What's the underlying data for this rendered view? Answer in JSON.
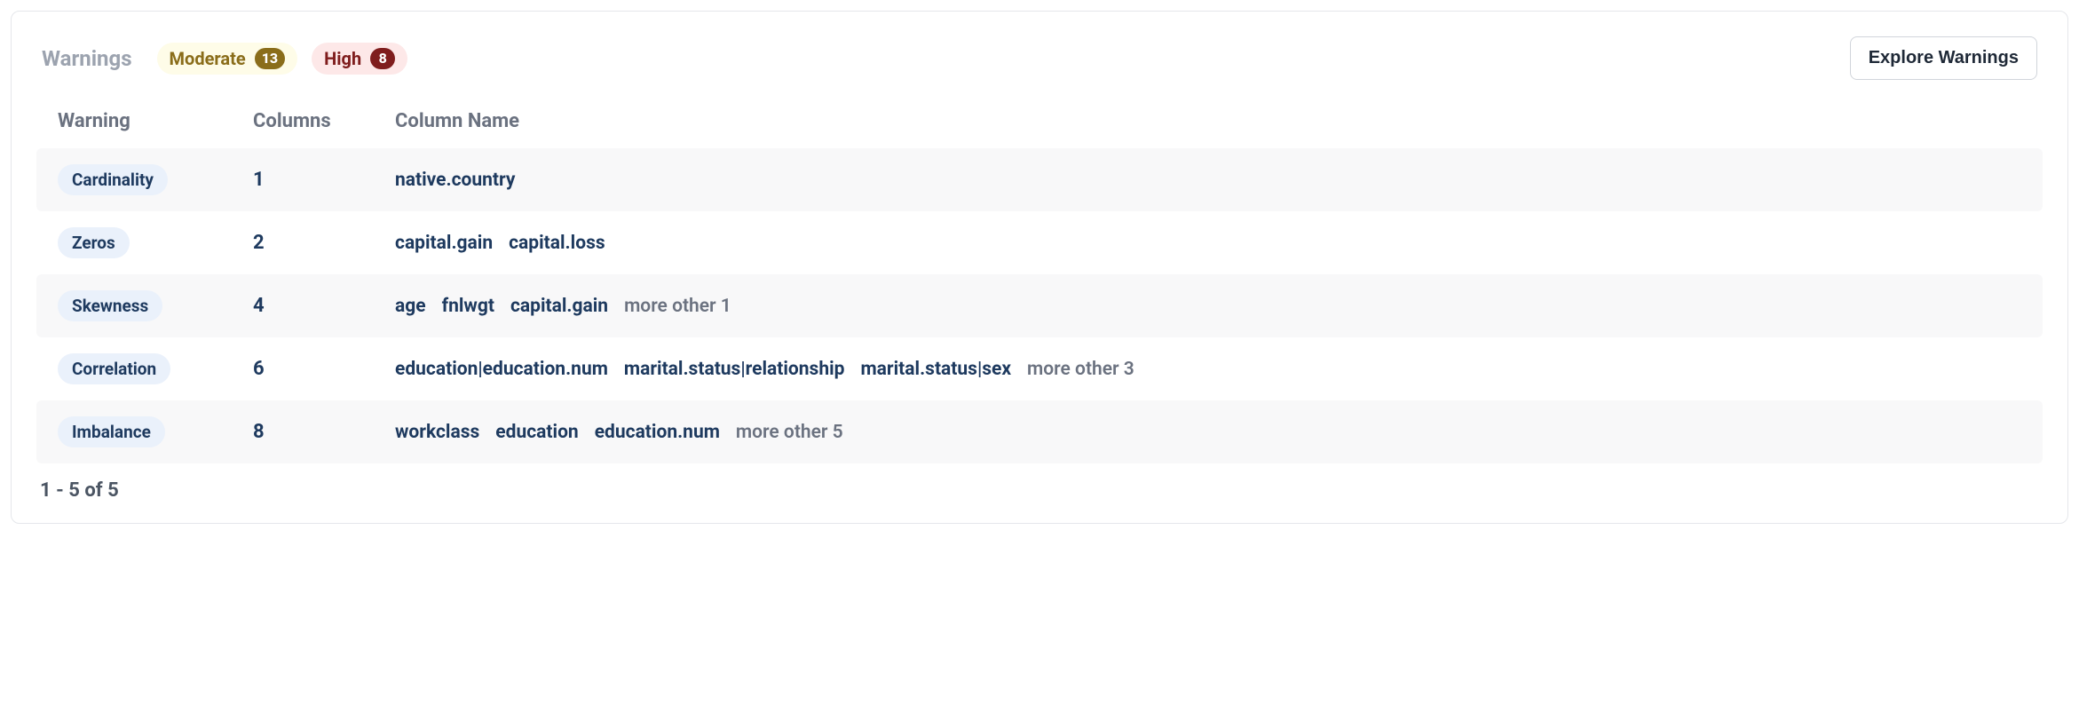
{
  "title": "Warnings",
  "filters": {
    "moderate": {
      "label": "Moderate",
      "count": "13"
    },
    "high": {
      "label": "High",
      "count": "8"
    }
  },
  "explore_label": "Explore Warnings",
  "columns": {
    "warning": "Warning",
    "count": "Columns",
    "name": "Column Name"
  },
  "rows": [
    {
      "warning": "Cardinality",
      "count": "1",
      "names": [
        "native.country"
      ],
      "more": ""
    },
    {
      "warning": "Zeros",
      "count": "2",
      "names": [
        "capital.gain",
        "capital.loss"
      ],
      "more": ""
    },
    {
      "warning": "Skewness",
      "count": "4",
      "names": [
        "age",
        "fnlwgt",
        "capital.gain"
      ],
      "more": "more other 1"
    },
    {
      "warning": "Correlation",
      "count": "6",
      "names": [
        "education|education.num",
        "marital.status|relationship",
        "marital.status|sex"
      ],
      "more": "more other 3"
    },
    {
      "warning": "Imbalance",
      "count": "8",
      "names": [
        "workclass",
        "education",
        "education.num"
      ],
      "more": "more other 5"
    }
  ],
  "pagination": "1 - 5 of 5"
}
